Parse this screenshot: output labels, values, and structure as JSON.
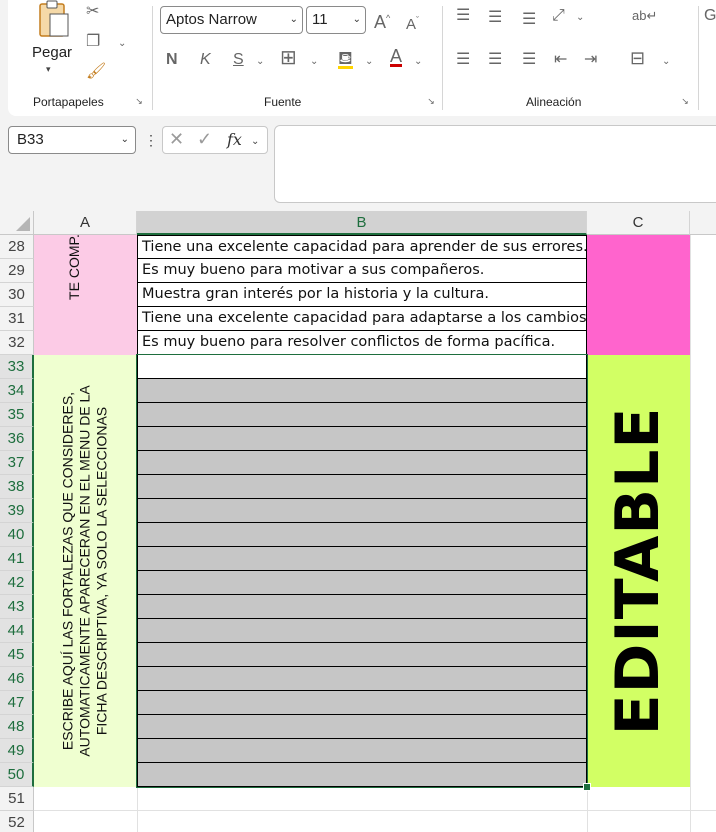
{
  "ribbon": {
    "clipboard": {
      "label": "Portapapeles",
      "paste_label": "Pegar"
    },
    "font": {
      "label": "Fuente",
      "font_name": "Aptos Narrow",
      "font_size": "11",
      "bold": "N",
      "italic": "K",
      "underline": "S"
    },
    "alignment": {
      "label": "Alineación"
    }
  },
  "formula_bar": {
    "name_box": "B33",
    "fx_label": "fx",
    "formula_value": ""
  },
  "columns": {
    "a": "A",
    "b": "B",
    "c": "C"
  },
  "rows": [
    "28",
    "29",
    "30",
    "31",
    "32",
    "33",
    "34",
    "35",
    "36",
    "37",
    "38",
    "39",
    "40",
    "41",
    "42",
    "43",
    "44",
    "45",
    "46",
    "47",
    "48",
    "49",
    "50",
    "51",
    "52"
  ],
  "cells": {
    "b28": "Tiene una excelente capacidad para aprender de sus errores.",
    "b29": "Es muy bueno para motivar a sus compañeros.",
    "b30": "Muestra gran interés por la historia y la cultura.",
    "b31": "Tiene una excelente capacidad para adaptarse a los cambios.",
    "b32": "Es muy bueno para resolver conflictos de forma pacífica.",
    "a28_merged": "TE COMP.",
    "a33_line1": "ESCRIBE AQUÍ LAS FORTALEZAS QUE CONSIDERES,",
    "a33_line2": "AUTOMATICAMENTE APARECERAN EN EL MENU DE LA",
    "a33_line3": "FICHA DESCRIPTIVA, YA SOLO LA SELECCIONAS",
    "c33_merged": "EDITABLE"
  },
  "colors": {
    "pink_light": "#fccbe6",
    "pink_strong": "#ff64cd",
    "green_light": "#efffd0",
    "lime": "#d2ff64",
    "gray_input": "#c6c6c6",
    "excel_green": "#1e6e3e"
  }
}
